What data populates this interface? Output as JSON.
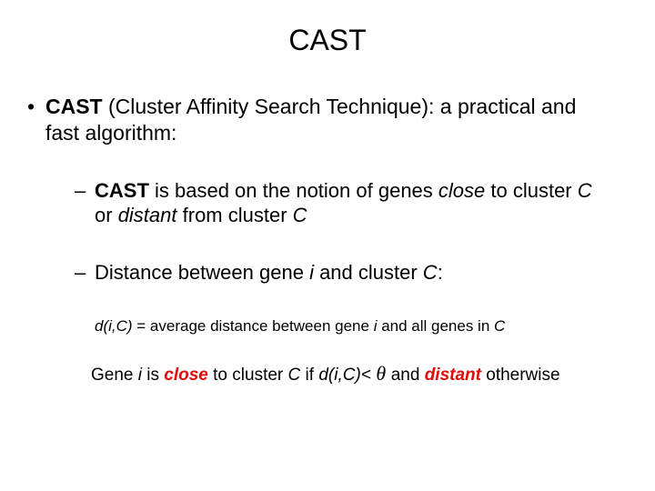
{
  "title": "CAST",
  "bullet1": {
    "prefix_bold": "CAST",
    "rest": " (Cluster Affinity Search Technique):  a practical and fast algorithm:"
  },
  "sub1": {
    "prefix_bold": "CAST",
    "t1": " is based on the notion of genes ",
    "close": "close",
    "t2": " to cluster ",
    "C1": "C",
    "t3": " or ",
    "distant": "distant",
    "t4": " from cluster ",
    "C2": "C"
  },
  "sub2": {
    "t1": "Distance between gene ",
    "i": "i",
    "t2": " and cluster ",
    "C": "C",
    "colon": ":"
  },
  "indent": {
    "diC": "d(i,C)",
    "t1": " = average distance between gene ",
    "i": "i",
    "t2": " and all genes in ",
    "C": "C"
  },
  "footer": {
    "t1": "Gene ",
    "i": "i",
    "t2": " is ",
    "close": "close",
    "t3": " to cluster ",
    "C": "C",
    "t4": " if ",
    "diC": "d(i,C)",
    "lt": "<",
    "theta": " θ ",
    "t5": " and ",
    "distant": "distant",
    "t6": " otherwise"
  }
}
